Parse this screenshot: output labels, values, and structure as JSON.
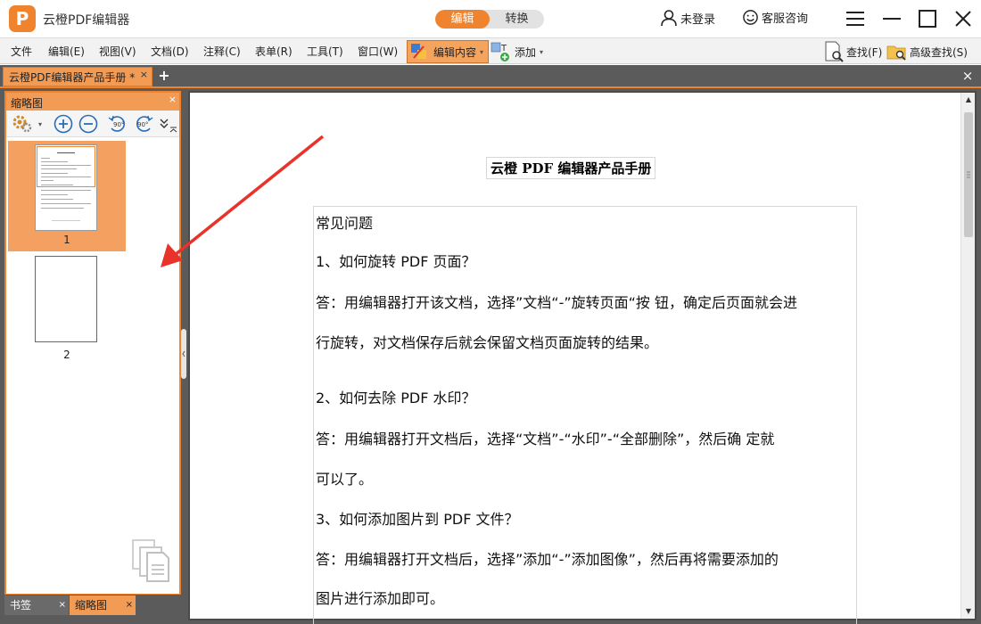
{
  "app": {
    "logo_letter": "P",
    "title": "云橙PDF编辑器",
    "modes": [
      "编辑",
      "转换"
    ],
    "active_mode": "编辑",
    "login_label": "未登录",
    "service_label": "客服咨询"
  },
  "menu": {
    "items": [
      "文件",
      "编辑(E)",
      "视图(V)",
      "文档(D)",
      "注释(C)",
      "表单(R)",
      "工具(T)",
      "窗口(W)"
    ],
    "edit_content_label": "编辑内容",
    "add_label": "添加",
    "find_label": "查找(F)",
    "advanced_find_label": "高级查找(S)"
  },
  "tabs": {
    "document_tab": "云橙PDF编辑器产品手册 *",
    "close_icon": "×",
    "new_tab_icon": "+"
  },
  "sidebar": {
    "title": "缩略图",
    "thumbnails": [
      {
        "label": "1",
        "selected": true
      },
      {
        "label": "2",
        "selected": false
      }
    ],
    "bottom_tabs": [
      "书签",
      "缩略图"
    ],
    "active_bottom_tab": "缩略图"
  },
  "document": {
    "title": "云橙 PDF 编辑器产品手册",
    "paragraphs": [
      "常见问题",
      "1、如何旋转 PDF 页面？",
      "答：用编辑器打开该文档，选择”文档“-”旋转页面“按 钮，确定后页面就会进",
      "行旋转，对文档保存后就会保留文档页面旋转的结果。",
      "2、如何去除 PDF 水印？",
      "答：用编辑器打开文档后，选择“文档”-“水印”-“全部删除”，然后确 定就",
      "可以了。",
      "3、如何添加图片到 PDF 文件？",
      "答：用编辑器打开文档后，选择”添加“-”添加图像”，然后再将需要添加的",
      "图片进行添加即可。"
    ]
  },
  "colors": {
    "accent": "#f0842e",
    "workspace_bg": "#5b5b5b",
    "annotation_arrow": "#e8322a"
  }
}
